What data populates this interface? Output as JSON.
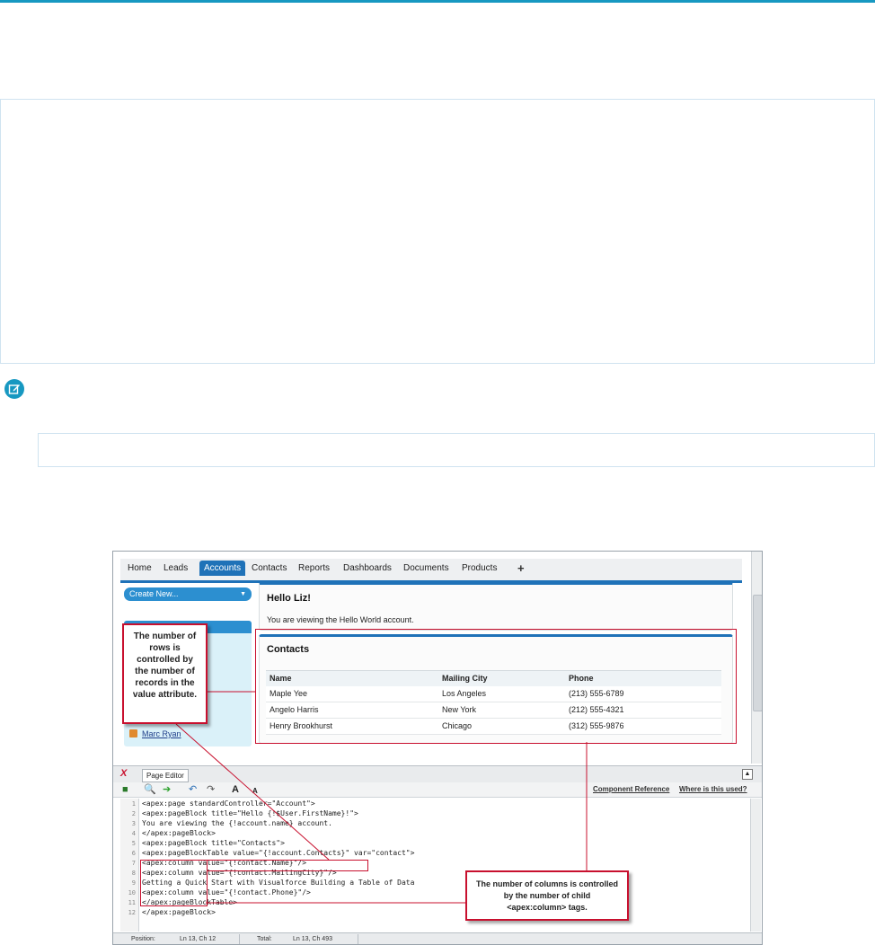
{
  "figure": {
    "tabs": [
      {
        "label": "Home",
        "active": false
      },
      {
        "label": "Leads",
        "active": false
      },
      {
        "label": "Accounts",
        "active": true
      },
      {
        "label": "Contacts",
        "active": false
      },
      {
        "label": "Reports",
        "active": false
      },
      {
        "label": "Dashboards",
        "active": false
      },
      {
        "label": "Documents",
        "active": false
      },
      {
        "label": "Products",
        "active": false
      }
    ],
    "tab_plus": "+",
    "sidebar": {
      "create_new": "Create New...",
      "recent_item": "Marc Ryan"
    },
    "hello_block": {
      "title": "Hello Liz!",
      "text": "You are viewing the Hello World account."
    },
    "contacts_block": {
      "title": "Contacts",
      "columns": [
        "Name",
        "Mailing City",
        "Phone"
      ],
      "rows": [
        [
          "Maple Yee",
          "Los Angeles",
          "(213) 555-6789"
        ],
        [
          "Angelo Harris",
          "New York",
          "(212) 555-4321"
        ],
        [
          "Henry Brookhurst",
          "Chicago",
          "(312) 555-9876"
        ]
      ]
    },
    "callout_rows": "The number of rows is controlled by the number of records in the value attribute.",
    "callout_columns": "The number of columns is controlled by the number of child <apex:column> tags.",
    "editor": {
      "tab": "Page Editor",
      "component_reference": "Component Reference",
      "where_used": "Where is this used?",
      "code_lines": [
        "<apex:page standardController=\"Account\">",
        "<apex:pageBlock title=\"Hello {!$User.FirstName}!\">",
        "You are viewing the {!account.name} account.",
        "</apex:pageBlock>",
        "<apex:pageBlock title=\"Contacts\">",
        "<apex:pageBlockTable value=\"{!account.Contacts}\" var=\"contact\">",
        "<apex:column value=\"{!contact.Name}\"/>",
        "<apex:column value=\"{!contact.MailingCity}\"/>",
        "Getting a Quick Start with Visualforce Building a Table of Data",
        "<apex:column value=\"{!contact.Phone}\"/>",
        "</apex:pageBlockTable>",
        "</apex:pageBlock>"
      ],
      "line_numbers": [
        "1",
        "2",
        "3",
        "4",
        "5",
        "6",
        "7",
        "8",
        "9",
        "10",
        "11",
        "12"
      ],
      "status": {
        "position_label": "Position:",
        "position_value": "Ln 13, Ch 12",
        "total_label": "Total:",
        "total_value": "Ln 13, Ch 493"
      }
    },
    "colors": {
      "accent": "#1798c1",
      "tab_blue": "#1f72b8",
      "callout_red": "#c8102e"
    }
  }
}
